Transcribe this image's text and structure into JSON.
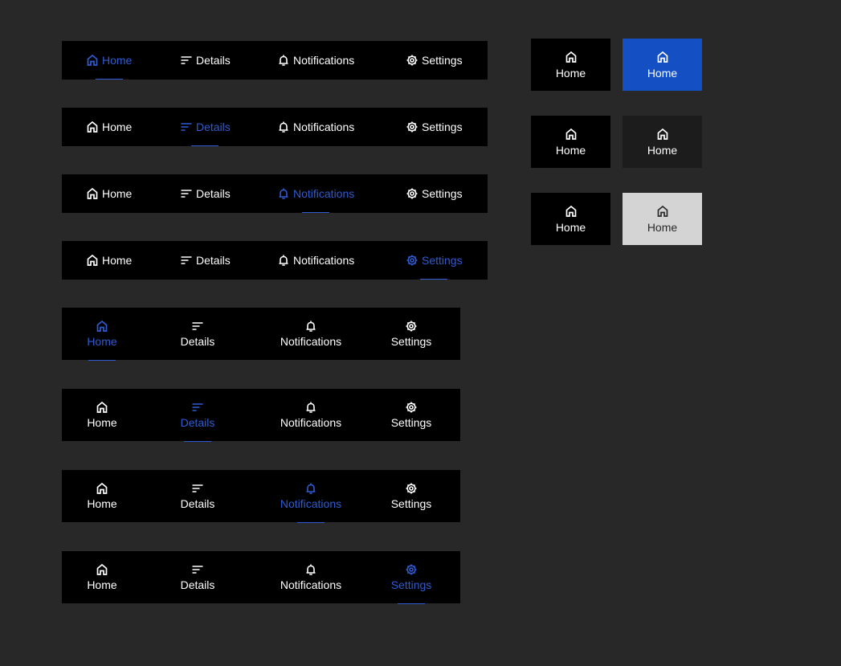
{
  "labels": {
    "home": "Home",
    "details": "Details",
    "notifications": "Notifications",
    "settings": "Settings"
  },
  "icons": {
    "home": "home-icon",
    "details": "sort-lines-icon",
    "notifications": "bell-icon",
    "settings": "gear-icon"
  },
  "colors": {
    "page_background": "#282828",
    "bar_background": "#000000",
    "text": "#ffffff",
    "accent": "#2f5bd3",
    "tile_blue": "#154fc4",
    "tile_dark": "#1c1c1c",
    "tile_light": "#d4d4d4",
    "tile_light_text": "#2a2a2a"
  },
  "horizontal_bars": [
    {
      "selected": "home"
    },
    {
      "selected": "details"
    },
    {
      "selected": "notifications"
    },
    {
      "selected": "settings"
    }
  ],
  "vertical_bars": [
    {
      "selected": "home"
    },
    {
      "selected": "details"
    },
    {
      "selected": "notifications"
    },
    {
      "selected": "settings"
    }
  ],
  "tile_pairs": [
    {
      "left": {
        "label": "Home",
        "style": "black"
      },
      "right": {
        "label": "Home",
        "style": "blue-selected"
      }
    },
    {
      "left": {
        "label": "Home",
        "style": "black"
      },
      "right": {
        "label": "Home",
        "style": "dark-hover"
      }
    },
    {
      "left": {
        "label": "Home",
        "style": "black"
      },
      "right": {
        "label": "Home",
        "style": "light-pressed"
      }
    }
  ]
}
